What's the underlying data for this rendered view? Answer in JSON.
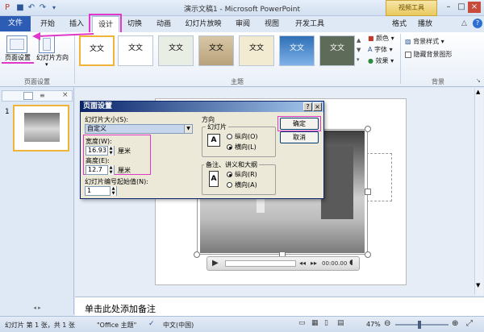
{
  "titlebar": {
    "title": "演示文稿1 - Microsoft PowerPoint",
    "context_tools": "视频工具",
    "qat_icons": [
      "save-icon",
      "undo-icon",
      "redo-icon",
      "customize-qat-icon"
    ],
    "window_buttons": [
      "minimize-icon",
      "maximize-icon",
      "close-icon"
    ]
  },
  "tabs": {
    "file": "文件",
    "items": [
      "开始",
      "插入",
      "设计",
      "切换",
      "动画",
      "幻灯片放映",
      "审阅",
      "视图",
      "开发工具",
      "格式",
      "播放"
    ],
    "active": "设计"
  },
  "ribbon": {
    "page_setup": "页面设置",
    "orientation": "幻灯片方向",
    "group_page_setup": "页面设置",
    "group_themes": "主题",
    "theme_text": "文文",
    "colors": "颜色",
    "fonts": "字体",
    "effects": "效果",
    "bg_styles": "背景样式",
    "hide_bg": "隐藏背景图形",
    "group_bg": "背景"
  },
  "panel": {
    "slide_number": "1"
  },
  "dialog": {
    "title": "页面设置",
    "help": "?",
    "close": "×",
    "size_label": "幻灯片大小(S):",
    "size_value": "自定义",
    "width_label": "宽度(W):",
    "width_value": "16.93",
    "width_unit": "厘米",
    "height_label": "高度(E):",
    "height_value": "12.7",
    "height_unit": "厘米",
    "numbering_label": "幻灯片编号起始值(N):",
    "numbering_value": "1",
    "orientation_heading": "方向",
    "slides_group": "幻灯片",
    "portrait": "纵向(O)",
    "landscape": "横向(L)",
    "notes_group": "备注、讲义和大纲",
    "notes_portrait": "纵向(R)",
    "notes_landscape": "横向(A)",
    "ok": "确定",
    "cancel": "取消"
  },
  "video": {
    "time": "00:00.00"
  },
  "notes": {
    "placeholder": "单击此处添加备注"
  },
  "status": {
    "slide_info": "幻灯片 第 1 张，共 1 张",
    "theme": "\"Office 主题\"",
    "language": "中文(中国)",
    "zoom": "47%"
  },
  "colors": {
    "file_tab": "#2c5cb4",
    "highlight": "#e038c8",
    "dialog_title": "#0a246a"
  }
}
